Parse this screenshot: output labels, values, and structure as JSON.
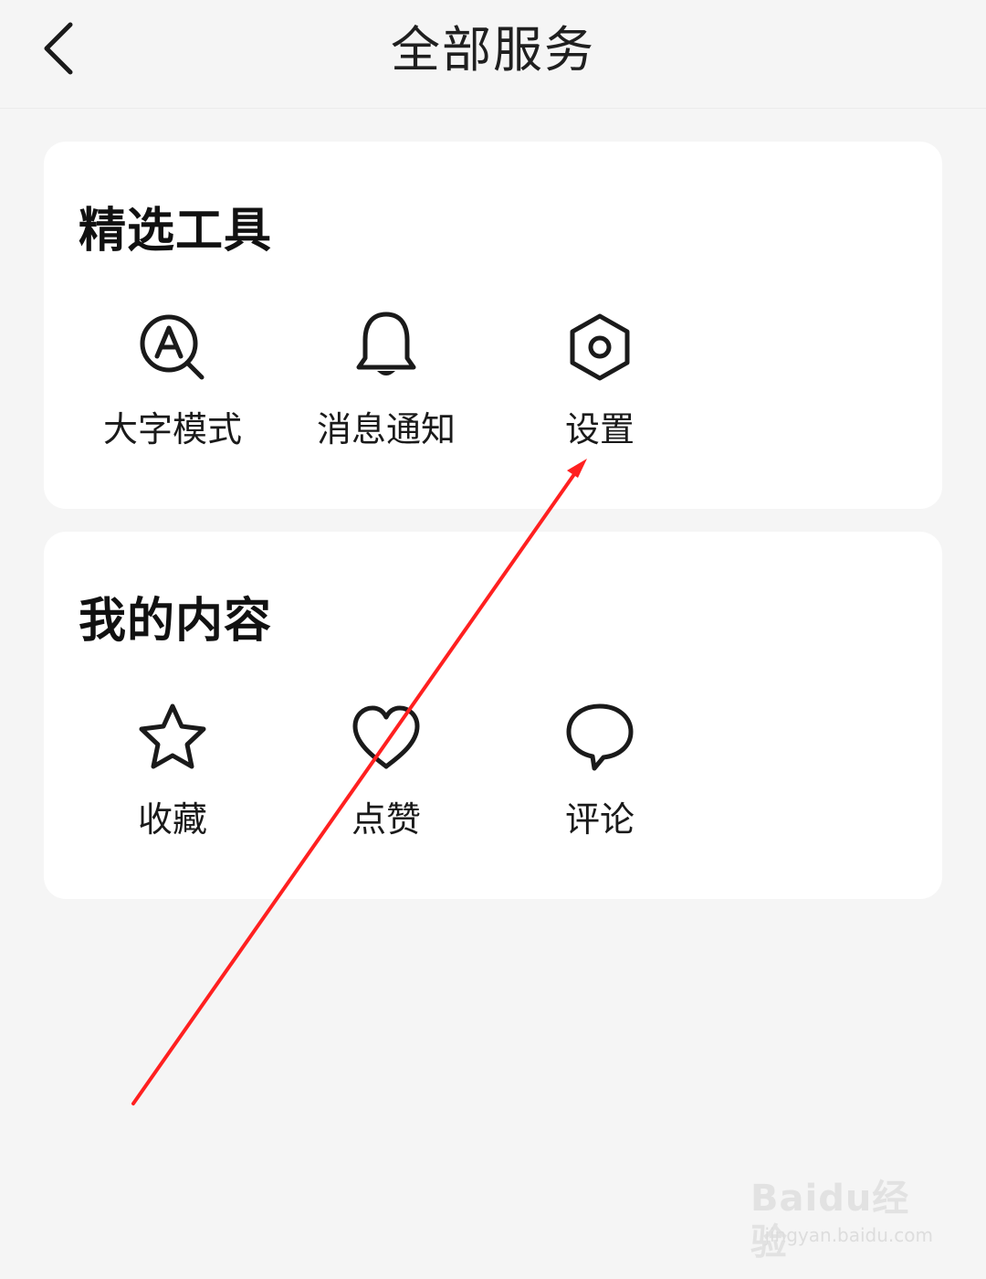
{
  "header": {
    "title": "全部服务",
    "back_icon": "chevron-left-icon"
  },
  "sections": [
    {
      "title": "精选工具",
      "items": [
        {
          "label": "大字模式",
          "icon": "font-search-icon"
        },
        {
          "label": "消息通知",
          "icon": "bell-icon"
        },
        {
          "label": "设置",
          "icon": "hexagon-gear-icon"
        }
      ]
    },
    {
      "title": "我的内容",
      "items": [
        {
          "label": "收藏",
          "icon": "star-icon"
        },
        {
          "label": "点赞",
          "icon": "heart-icon"
        },
        {
          "label": "评论",
          "icon": "speech-bubble-icon"
        }
      ]
    }
  ],
  "watermark": {
    "brand": "Baidu经验",
    "url": "jingyan.baidu.com"
  },
  "colors": {
    "background": "#f5f5f5",
    "card": "#ffffff",
    "annotation_arrow": "#ff2020",
    "icon_stroke": "#1a1a1a"
  }
}
